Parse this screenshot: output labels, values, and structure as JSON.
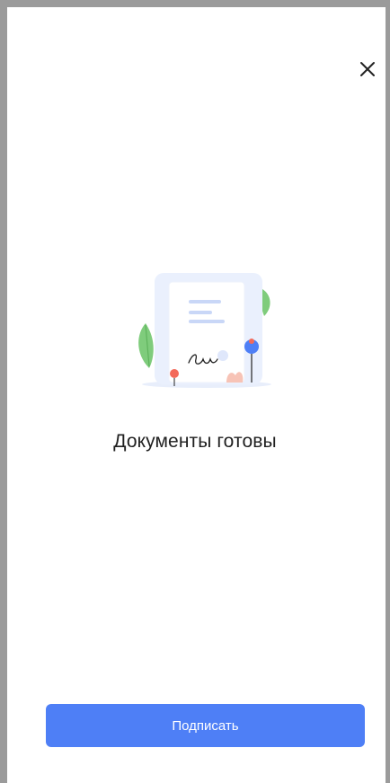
{
  "header": {
    "close_icon": "close-icon"
  },
  "main": {
    "illustration_icon": "signed-document-illustration",
    "title": "Документы готовы"
  },
  "footer": {
    "sign_button_label": "Подписать"
  },
  "colors": {
    "primary": "#4e7ff6",
    "frame": "#9b9b9b",
    "text": "#1f1f1f"
  }
}
